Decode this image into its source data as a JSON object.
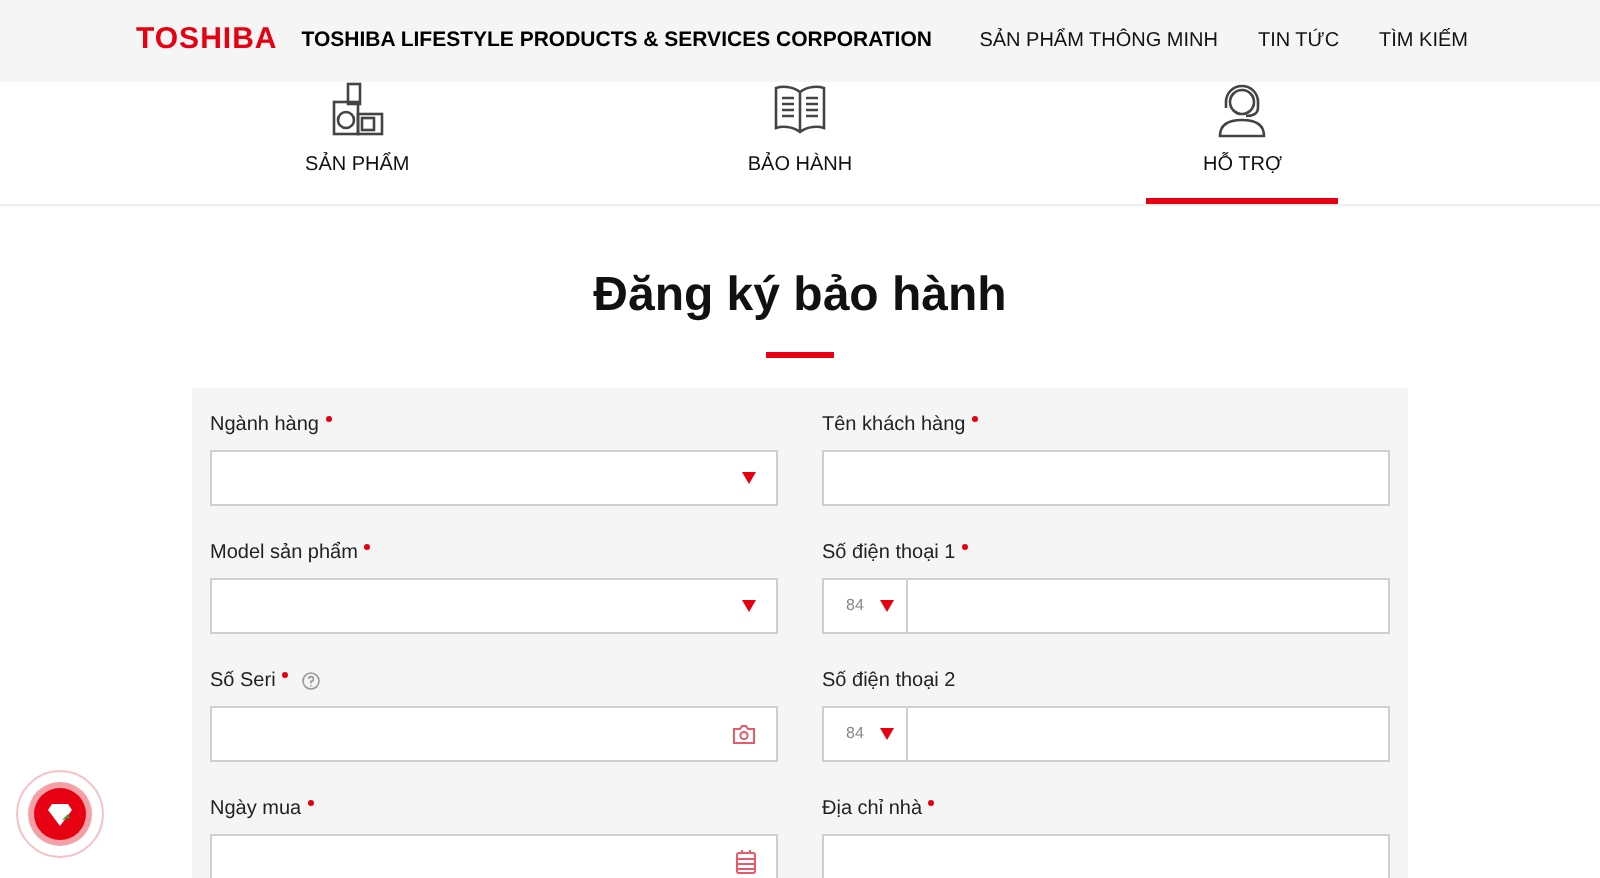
{
  "header": {
    "logo": "TOSHIBA",
    "company": "TOSHIBA LIFESTYLE PRODUCTS & SERVICES CORPORATION",
    "nav": [
      "SẢN PHẨM THÔNG MINH",
      "TIN TỨC",
      "TÌM KIẾM"
    ]
  },
  "tabs": [
    {
      "label": "SẢN PHẨM",
      "kind": "appliances",
      "selected": false
    },
    {
      "label": "BẢO HÀNH",
      "kind": "book",
      "selected": false
    },
    {
      "label": "HỖ TRỢ",
      "kind": "support",
      "selected": true
    }
  ],
  "title": "Đăng ký bảo hành",
  "form": {
    "columns": [
      [
        {
          "label": "Ngành hàng",
          "required": true,
          "help": false,
          "kind": "select"
        },
        {
          "label": "Model sản phẩm",
          "required": true,
          "help": false,
          "kind": "select"
        },
        {
          "label": "Số Seri",
          "required": true,
          "help": true,
          "kind": "camera"
        },
        {
          "label": "Ngày mua",
          "required": true,
          "help": false,
          "kind": "date"
        }
      ],
      [
        {
          "label": "Tên khách hàng",
          "required": true,
          "help": false,
          "kind": "text"
        },
        {
          "label": "Số điện thoại 1",
          "required": true,
          "help": false,
          "kind": "phone",
          "code": "84"
        },
        {
          "label": "Số điện thoại 2",
          "required": false,
          "help": false,
          "kind": "phone",
          "code": "84"
        },
        {
          "label": "Địa chỉ nhà",
          "required": true,
          "help": false,
          "kind": "text"
        }
      ]
    ]
  }
}
